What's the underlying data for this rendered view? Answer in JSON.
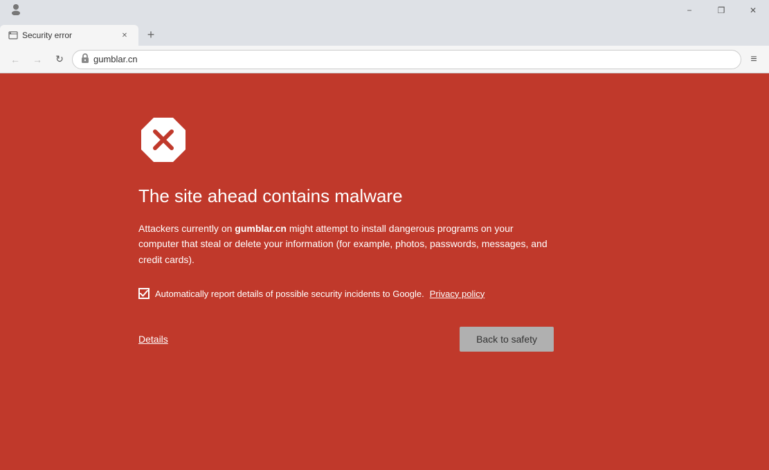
{
  "titlebar": {
    "user_icon": "👤",
    "minimize_label": "−",
    "restore_label": "❐",
    "close_label": "✕"
  },
  "tab": {
    "favicon": "📄",
    "title": "Security error",
    "close_icon": "✕"
  },
  "newtab": {
    "icon": "+"
  },
  "navbar": {
    "back_icon": "←",
    "forward_icon": "→",
    "reload_icon": "↻",
    "address": "gumblar.cn",
    "lock_icon": "🔒",
    "menu_icon": "≡"
  },
  "page": {
    "heading": "The site ahead contains malware",
    "description_before": "Attackers currently on ",
    "domain": "gumblar.cn",
    "description_after": " might attempt to install dangerous programs on your computer that steal or delete your information (for example, photos, passwords, messages, and credit cards).",
    "checkbox_label": "Automatically report details of possible security incidents to Google.",
    "privacy_link": "Privacy policy",
    "details_link": "Details",
    "back_button": "Back to safety"
  },
  "colors": {
    "page_bg": "#c0392b",
    "button_bg": "#b3b3b3"
  }
}
